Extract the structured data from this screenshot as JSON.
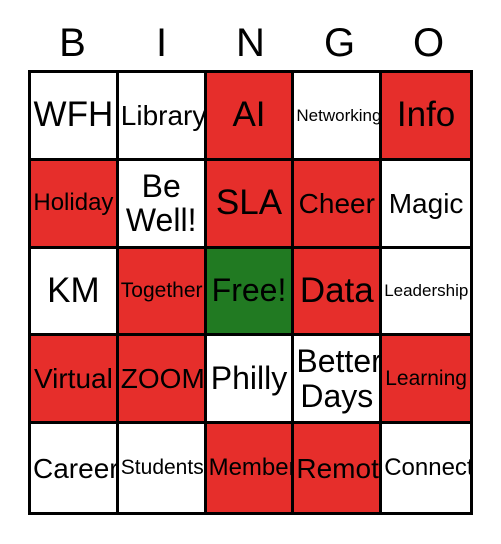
{
  "card": {
    "title": "BINGO",
    "header_letters": [
      "B",
      "I",
      "N",
      "G",
      "O"
    ],
    "colors": {
      "marked_red": "#e62e2b",
      "free_green": "#217a22",
      "unmarked_white": "#ffffff",
      "border_black": "#000000",
      "text_black": "#000000"
    },
    "rows": [
      [
        {
          "label": "WFH",
          "state": "unmarked",
          "fill": "white",
          "size": "xl",
          "lines": 1
        },
        {
          "label": "Library",
          "state": "unmarked",
          "fill": "white",
          "size": "md",
          "lines": 1
        },
        {
          "label": "AI",
          "state": "marked",
          "fill": "red",
          "size": "xl",
          "lines": 1
        },
        {
          "label": "Networking",
          "state": "unmarked",
          "fill": "white",
          "size": "xxs",
          "lines": 1
        },
        {
          "label": "Info",
          "state": "marked",
          "fill": "red",
          "size": "xl",
          "lines": 1
        }
      ],
      [
        {
          "label": "Holiday",
          "state": "marked",
          "fill": "red",
          "size": "sm",
          "lines": 1
        },
        {
          "label": "Be\nWell!",
          "state": "unmarked",
          "fill": "white",
          "size": "lg",
          "lines": 2
        },
        {
          "label": "SLA",
          "state": "marked",
          "fill": "red",
          "size": "xl",
          "lines": 1
        },
        {
          "label": "Cheer",
          "state": "marked",
          "fill": "red",
          "size": "md",
          "lines": 1
        },
        {
          "label": "Magic",
          "state": "unmarked",
          "fill": "white",
          "size": "md",
          "lines": 1
        }
      ],
      [
        {
          "label": "KM",
          "state": "unmarked",
          "fill": "white",
          "size": "xl",
          "lines": 1
        },
        {
          "label": "Together",
          "state": "marked",
          "fill": "red",
          "size": "xs",
          "lines": 1
        },
        {
          "label": "Free!",
          "state": "free",
          "fill": "green",
          "size": "lg",
          "lines": 1
        },
        {
          "label": "Data",
          "state": "marked",
          "fill": "red",
          "size": "xl",
          "lines": 1
        },
        {
          "label": "Leadership",
          "state": "unmarked",
          "fill": "white",
          "size": "xxs",
          "lines": 1
        }
      ],
      [
        {
          "label": "Virtual",
          "state": "marked",
          "fill": "red",
          "size": "md",
          "lines": 1
        },
        {
          "label": "ZOOM",
          "state": "marked",
          "fill": "red",
          "size": "md",
          "lines": 1
        },
        {
          "label": "Philly",
          "state": "unmarked",
          "fill": "white",
          "size": "lg",
          "lines": 1
        },
        {
          "label": "Better\nDays",
          "state": "unmarked",
          "fill": "white",
          "size": "lg",
          "lines": 2
        },
        {
          "label": "Learning",
          "state": "marked",
          "fill": "red",
          "size": "xs",
          "lines": 1
        }
      ],
      [
        {
          "label": "Career",
          "state": "unmarked",
          "fill": "white",
          "size": "md",
          "lines": 1
        },
        {
          "label": "Students",
          "state": "unmarked",
          "fill": "white",
          "size": "xs",
          "lines": 1
        },
        {
          "label": "Members",
          "state": "marked",
          "fill": "red",
          "size": "sm",
          "lines": 1
        },
        {
          "label": "Remote",
          "state": "marked",
          "fill": "red",
          "size": "md",
          "lines": 1
        },
        {
          "label": "Connect",
          "state": "unmarked",
          "fill": "white",
          "size": "sm",
          "lines": 1
        }
      ]
    ]
  }
}
